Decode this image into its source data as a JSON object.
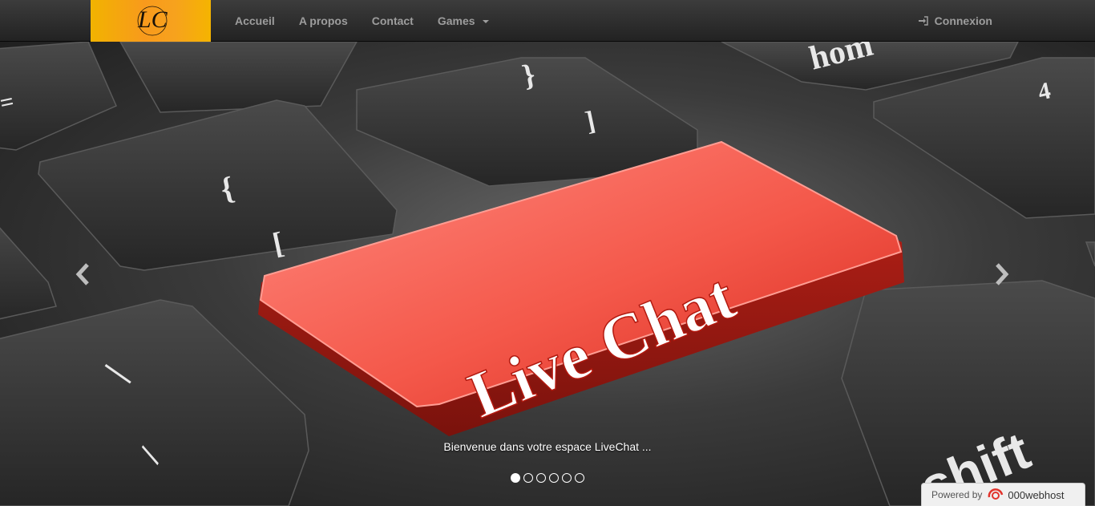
{
  "nav": {
    "items": [
      {
        "label": "Accueil"
      },
      {
        "label": "A propos"
      },
      {
        "label": "Contact"
      },
      {
        "label": "Games"
      }
    ],
    "login_label": "Connexion"
  },
  "logo": {
    "text": "LC"
  },
  "slide": {
    "key_text": "Live Chat",
    "shift_text": "shift",
    "home_text": "hom",
    "caption": "Bienvenue dans votre espace LiveChat ...",
    "indicator_count": 6,
    "active_index": 0
  },
  "footer_badge": {
    "prefix": "Powered by",
    "brand": "000webhost"
  },
  "colors": {
    "navbar": "#2b2b2b",
    "nav_text": "#9d9d9d",
    "logo_bg": "#f89a1c",
    "key_red": "#f24a3c"
  }
}
